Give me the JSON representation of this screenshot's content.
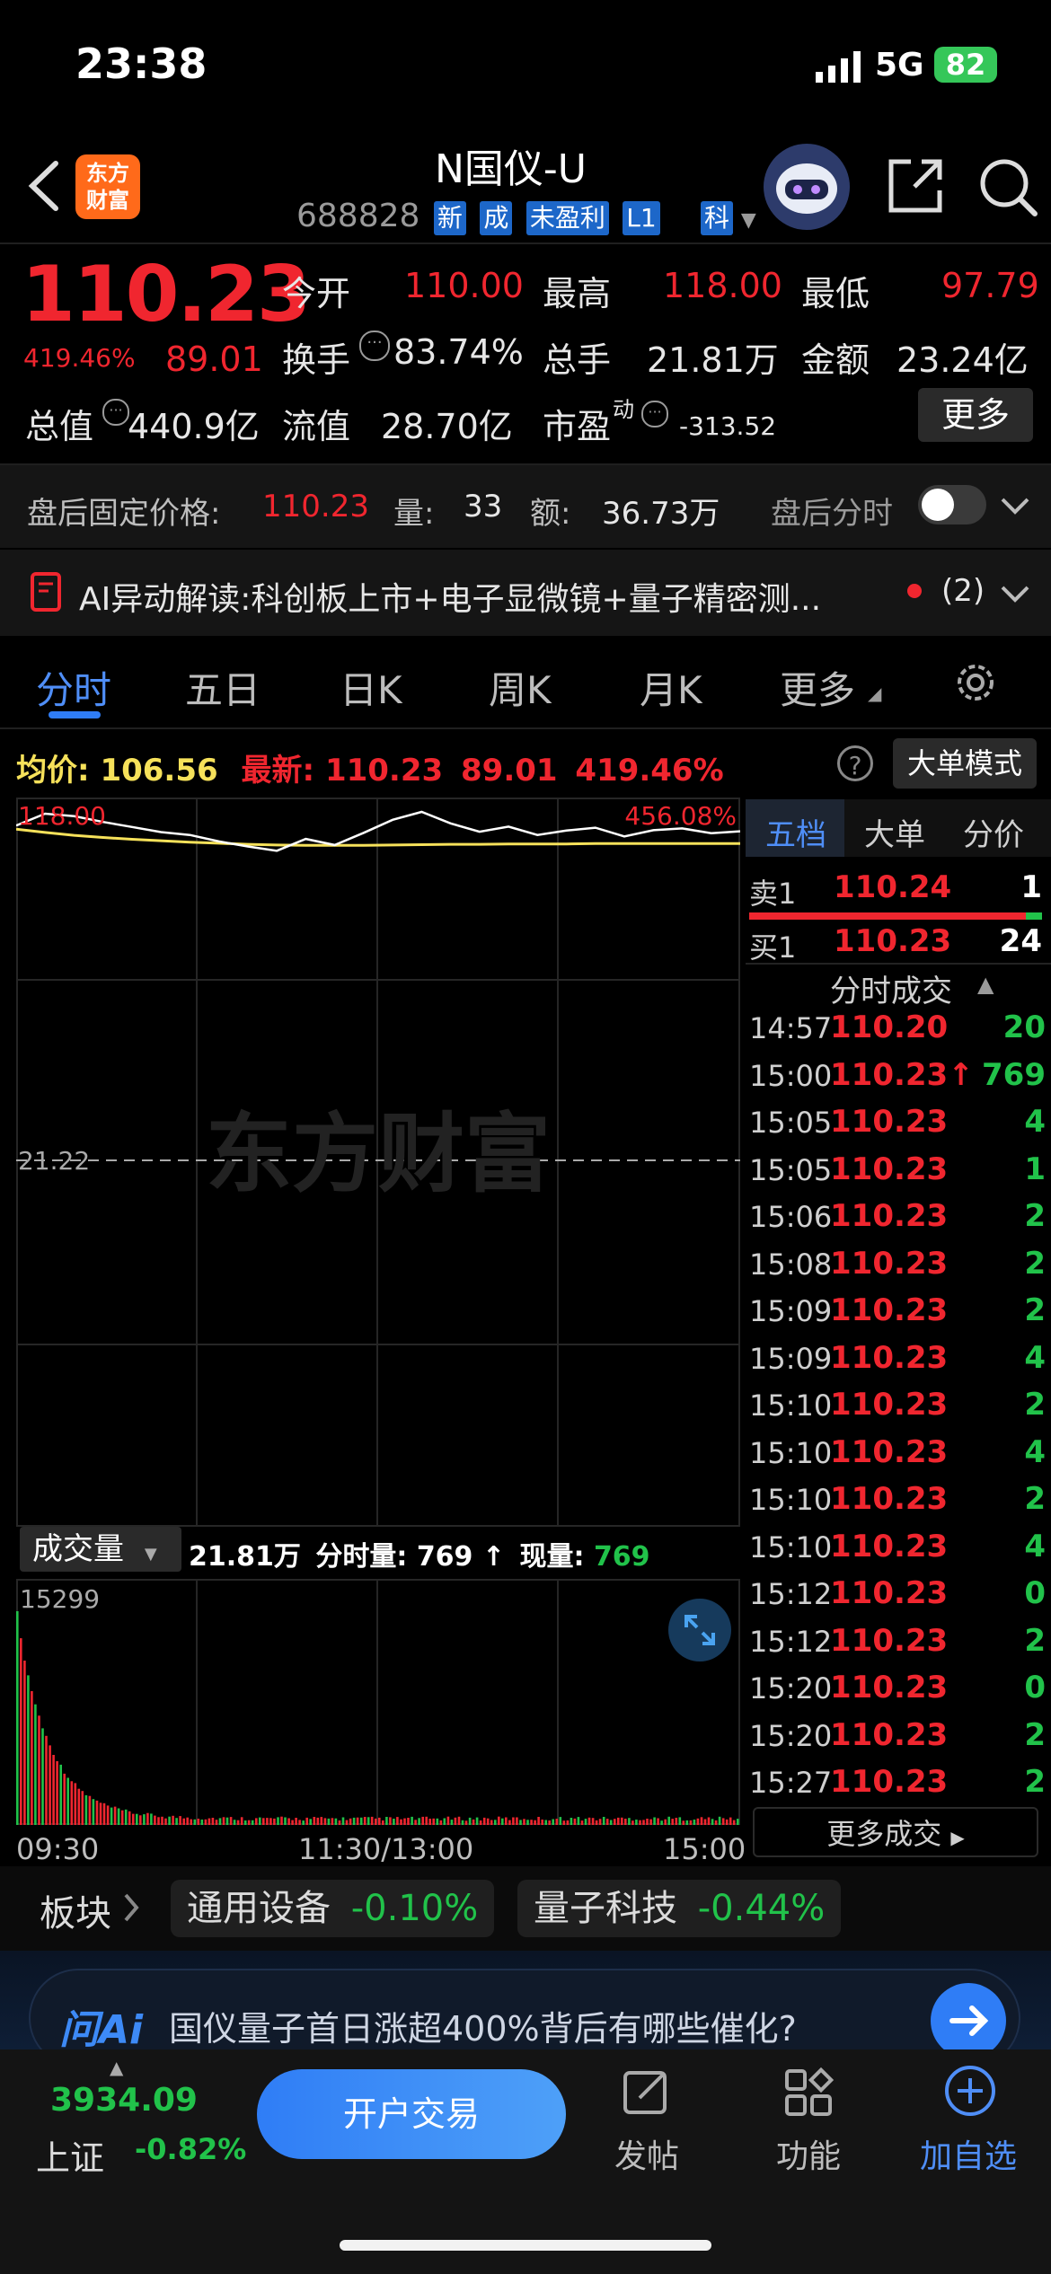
{
  "status": {
    "time": "23:38",
    "network": "5G",
    "battery": "82"
  },
  "header": {
    "logo_line1": "东方",
    "logo_line2": "财富",
    "title": "N国仪-U",
    "code": "688828",
    "tags": [
      "新",
      "成",
      "未盈利",
      "L1"
    ],
    "board_tag": "科"
  },
  "quote": {
    "price": "110.23",
    "change_pct": "419.46%",
    "change": "89.01",
    "open_label": "今开",
    "open": "110.00",
    "high_label": "最高",
    "high": "118.00",
    "low_label": "最低",
    "low": "97.79",
    "turnover_label": "换手",
    "turnover": "83.74%",
    "volume_label": "总手",
    "volume": "21.81万",
    "amount_label": "金额",
    "amount": "23.24亿",
    "mktcap_label": "总值",
    "mktcap": "440.9亿",
    "float_label": "流值",
    "float": "28.70亿",
    "pe_label": "市盈",
    "pe_sup": "动",
    "pe": "-313.52",
    "more": "更多"
  },
  "afterhours": {
    "label": "盘后固定价格:",
    "price": "110.23",
    "vol_label": "量:",
    "vol": "33",
    "amt_label": "额:",
    "amt": "36.73万",
    "chart_label": "盘后分时"
  },
  "ai_banner": {
    "text": "AI异动解读:科创板上市+电子显微镜+量子精密测...",
    "count": "(2)"
  },
  "tabs": [
    "分时",
    "五日",
    "日K",
    "周K",
    "月K",
    "更多"
  ],
  "chart_header": {
    "avg_label": "均价:",
    "avg": "106.56",
    "last_label": "最新:",
    "last": "110.23",
    "chg": "89.01",
    "pct": "419.46%",
    "mode_btn": "大单模式"
  },
  "chart_data": {
    "type": "line",
    "y_top_label": "118.00",
    "y_mid_label": "21.22",
    "pct_top_label": "456.08%",
    "price_series": [
      114.2,
      117.5,
      116.8,
      115.2,
      113.8,
      112.4,
      111.6,
      109.8,
      108.4,
      107.2,
      110.5,
      108.8,
      112.2,
      115.8,
      118.0,
      114.8,
      112.5,
      113.9,
      111.6,
      112.8,
      113.6,
      111.2,
      112.9,
      113.4,
      112.1,
      112.6
    ],
    "avg_series": [
      113.2,
      112.3,
      111.5,
      110.9,
      110.4,
      110.0,
      109.6,
      109.3,
      109.0,
      108.8,
      108.7,
      108.7,
      108.7,
      108.8,
      108.9,
      109.0,
      109.0,
      109.1,
      109.1,
      109.1,
      109.2,
      109.2,
      109.2,
      109.2,
      109.2,
      109.2
    ],
    "watermark": "东方财富",
    "x_labels": [
      "09:30",
      "11:30/13:00",
      "15:00"
    ],
    "volume_label": "成交量",
    "volume_total": "21.81万",
    "volume_minute_label": "分时量:",
    "volume_minute": "769",
    "volume_now_label": "现量:",
    "volume_now": "769",
    "volume_max": "15299"
  },
  "orderbook": {
    "tabs": [
      "五档",
      "大单",
      "分价"
    ],
    "ask_label": "卖1",
    "ask_price": "110.24",
    "ask_vol": "1",
    "bid_label": "买1",
    "bid_price": "110.23",
    "bid_vol": "24",
    "trades_title": "分时成交",
    "trades": [
      {
        "t": "14:57",
        "p": "110.20",
        "v": "20",
        "c": "green"
      },
      {
        "t": "15:00",
        "p": "110.23↑",
        "v": "769",
        "c": "green"
      },
      {
        "t": "15:05",
        "p": "110.23",
        "v": "4",
        "c": "green"
      },
      {
        "t": "15:05",
        "p": "110.23",
        "v": "1",
        "c": "green"
      },
      {
        "t": "15:06",
        "p": "110.23",
        "v": "2",
        "c": "green"
      },
      {
        "t": "15:08",
        "p": "110.23",
        "v": "2",
        "c": "green"
      },
      {
        "t": "15:09",
        "p": "110.23",
        "v": "2",
        "c": "green"
      },
      {
        "t": "15:09",
        "p": "110.23",
        "v": "4",
        "c": "green"
      },
      {
        "t": "15:10",
        "p": "110.23",
        "v": "2",
        "c": "green"
      },
      {
        "t": "15:10",
        "p": "110.23",
        "v": "4",
        "c": "green"
      },
      {
        "t": "15:10",
        "p": "110.23",
        "v": "2",
        "c": "green"
      },
      {
        "t": "15:10",
        "p": "110.23",
        "v": "4",
        "c": "green"
      },
      {
        "t": "15:12",
        "p": "110.23",
        "v": "0",
        "c": "green"
      },
      {
        "t": "15:12",
        "p": "110.23",
        "v": "2",
        "c": "green"
      },
      {
        "t": "15:20",
        "p": "110.23",
        "v": "0",
        "c": "green"
      },
      {
        "t": "15:20",
        "p": "110.23",
        "v": "2",
        "c": "green"
      },
      {
        "t": "15:27",
        "p": "110.23",
        "v": "2",
        "c": "green"
      }
    ],
    "more_trades": "更多成交"
  },
  "sectors": {
    "label": "板块",
    "items": [
      {
        "name": "通用设备",
        "pct": "-0.10%"
      },
      {
        "name": "量子科技",
        "pct": "-0.44%"
      }
    ]
  },
  "ask_ai": {
    "brand": "问Ai",
    "question": "国仪量子首日涨超400%背后有哪些催化?"
  },
  "bottom": {
    "index_value": "3934.09",
    "index_name": "上证",
    "index_pct": "-0.82%",
    "trade_btn": "开户交易",
    "post": "发帖",
    "func": "功能",
    "watch": "加自选"
  }
}
